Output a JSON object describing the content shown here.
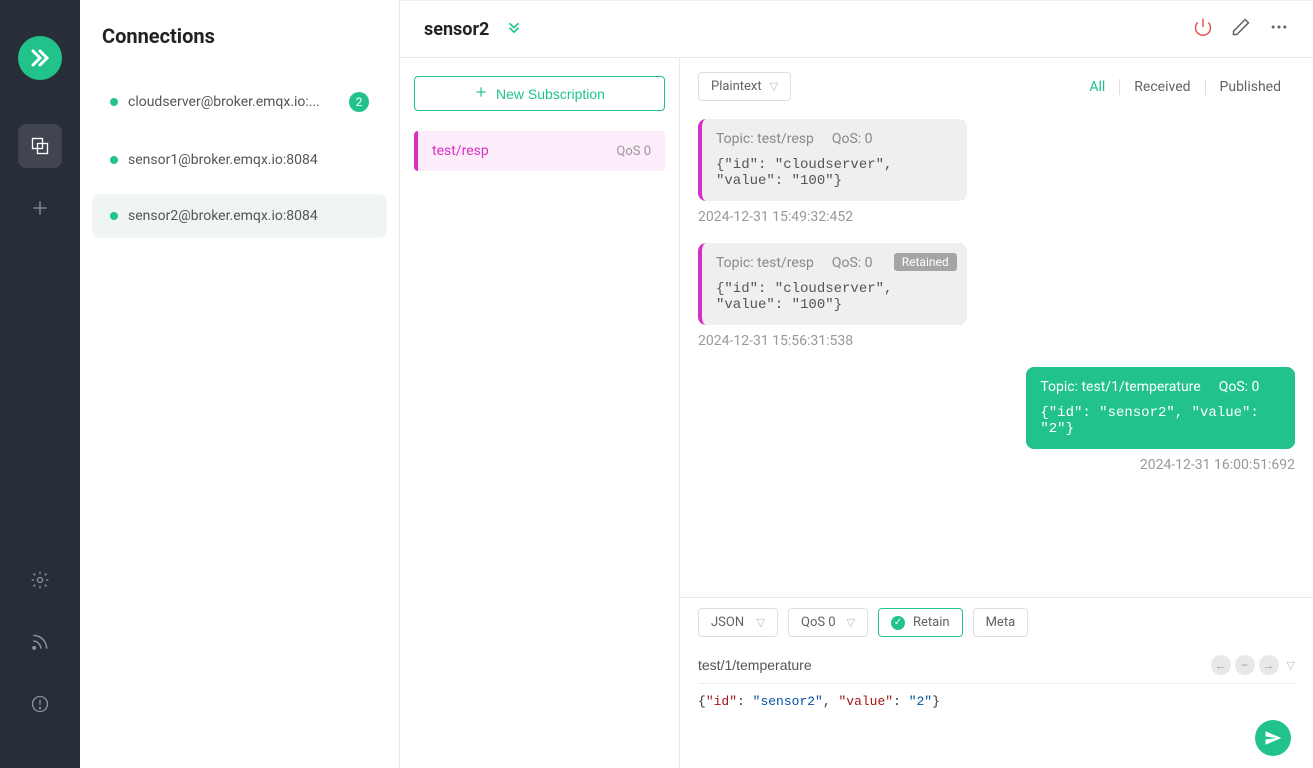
{
  "sidebar": {
    "title": "Connections",
    "items": [
      {
        "name": "cloudserver@broker.emqx.io:...",
        "badge": "2"
      },
      {
        "name": "sensor1@broker.emqx.io:8084"
      },
      {
        "name": "sensor2@broker.emqx.io:8084"
      }
    ]
  },
  "title_bar": {
    "connection_name": "sensor2"
  },
  "subscriptions": {
    "new_button": "New Subscription",
    "items": [
      {
        "topic": "test/resp",
        "qos": "QoS 0"
      }
    ]
  },
  "messages": {
    "format_select": "Plaintext",
    "filters": {
      "all": "All",
      "received": "Received",
      "published": "Published"
    },
    "list": [
      {
        "direction": "received",
        "topic_label": "Topic: test/resp",
        "qos_label": "QoS: 0",
        "payload": "{\"id\": \"cloudserver\", \"value\": \"100\"}",
        "timestamp": "2024-12-31 15:49:32:452",
        "retained": false
      },
      {
        "direction": "received",
        "topic_label": "Topic: test/resp",
        "qos_label": "QoS: 0",
        "payload": "{\"id\": \"cloudserver\", \"value\": \"100\"}",
        "timestamp": "2024-12-31 15:56:31:538",
        "retained": true,
        "retained_label": "Retained"
      },
      {
        "direction": "published",
        "topic_label": "Topic: test/1/temperature",
        "qos_label": "QoS: 0",
        "payload": "{\"id\": \"sensor2\", \"value\": \"2\"}",
        "timestamp": "2024-12-31 16:00:51:692",
        "retained": false
      }
    ]
  },
  "publish": {
    "payload_select": "JSON",
    "qos_select": "QoS 0",
    "retain_label": "Retain",
    "meta_label": "Meta",
    "topic_value": "test/1/temperature",
    "payload_raw": "{\"id\": \"sensor2\", \"value\": \"2\"}",
    "payload_tokens": [
      {
        "t": "p",
        "v": "{"
      },
      {
        "t": "k",
        "v": "\"id\""
      },
      {
        "t": "p",
        "v": ": "
      },
      {
        "t": "s",
        "v": "\"sensor2\""
      },
      {
        "t": "p",
        "v": ", "
      },
      {
        "t": "k",
        "v": "\"value\""
      },
      {
        "t": "p",
        "v": ": "
      },
      {
        "t": "s",
        "v": "\"2\""
      },
      {
        "t": "p",
        "v": "}"
      }
    ]
  }
}
